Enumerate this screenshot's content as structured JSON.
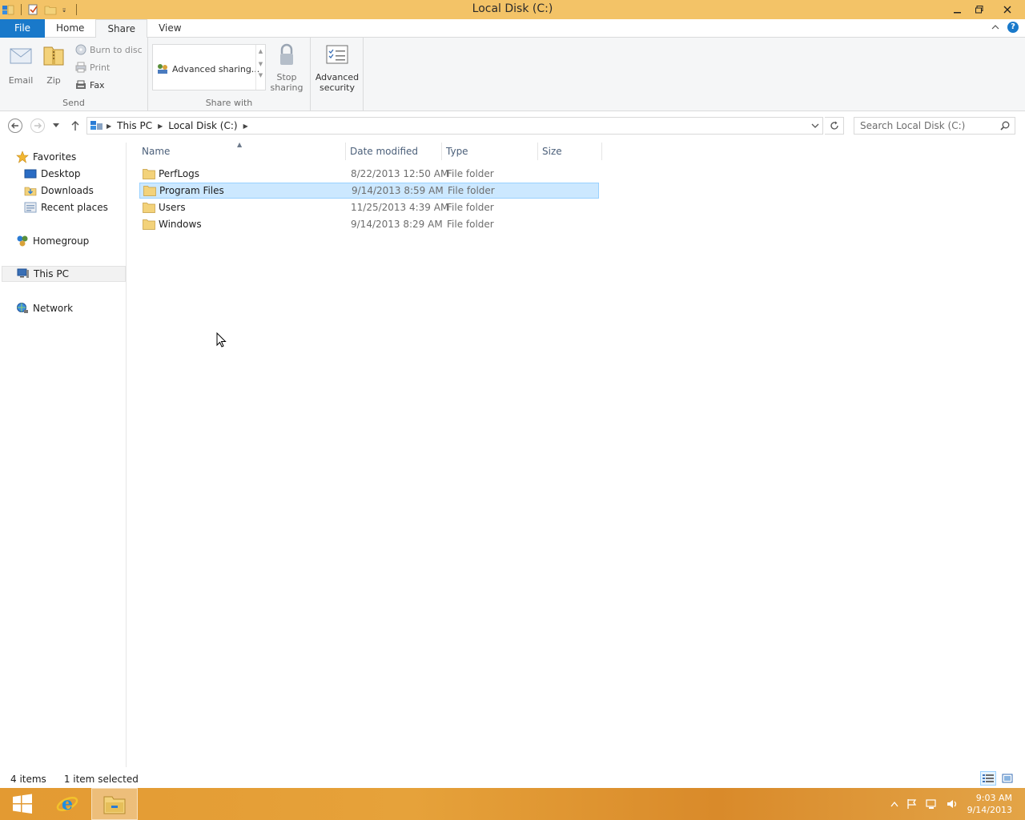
{
  "window": {
    "title": "Local Disk (C:)"
  },
  "ribbon": {
    "tabs": {
      "file": "File",
      "home": "Home",
      "share": "Share",
      "view": "View"
    },
    "send": {
      "label": "Send",
      "email": "Email",
      "zip": "Zip",
      "burn": "Burn to disc",
      "print": "Print",
      "fax": "Fax"
    },
    "share_with": {
      "label": "Share with",
      "item": "Advanced sharing..."
    },
    "stop_sharing": {
      "line1": "Stop",
      "line2": "sharing"
    },
    "advanced_security": {
      "line1": "Advanced",
      "line2": "security"
    }
  },
  "address": {
    "crumbs": [
      "This PC",
      "Local Disk (C:)"
    ]
  },
  "search": {
    "placeholder": "Search Local Disk (C:)"
  },
  "nav": {
    "favorites": "Favorites",
    "desktop": "Desktop",
    "downloads": "Downloads",
    "recent": "Recent places",
    "homegroup": "Homegroup",
    "this_pc": "This PC",
    "network": "Network"
  },
  "columns": {
    "name": "Name",
    "date": "Date modified",
    "type": "Type",
    "size": "Size"
  },
  "files": [
    {
      "name": "PerfLogs",
      "date": "8/22/2013 12:50 AM",
      "type": "File folder"
    },
    {
      "name": "Program Files",
      "date": "9/14/2013 8:59 AM",
      "type": "File folder"
    },
    {
      "name": "Users",
      "date": "11/25/2013 4:39 AM",
      "type": "File folder"
    },
    {
      "name": "Windows",
      "date": "9/14/2013 8:29 AM",
      "type": "File folder"
    }
  ],
  "status": {
    "count": "4 items",
    "selected": "1 item selected"
  },
  "taskbar": {
    "time": "9:03 AM",
    "date": "9/14/2013"
  },
  "colors": {
    "title_bar": "#f3c367",
    "file_tab": "#1979ca",
    "selection": "#cce8ff",
    "taskbar": "#e39a32"
  }
}
